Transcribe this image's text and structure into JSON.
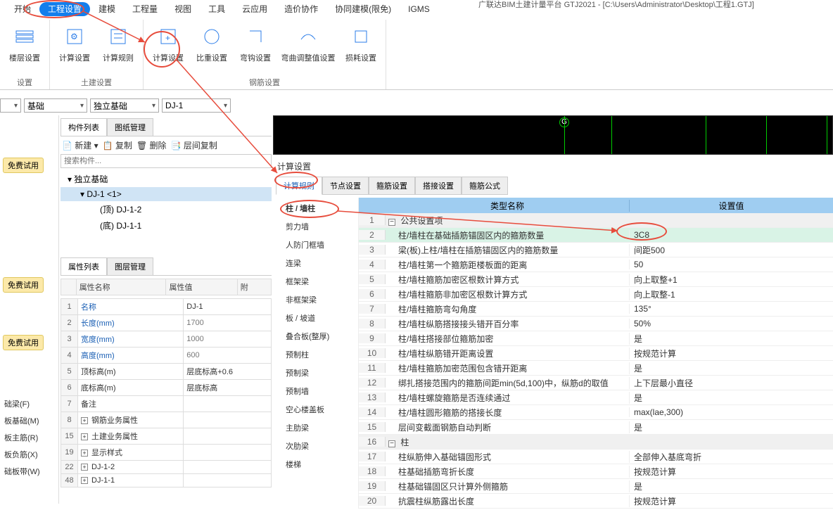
{
  "title": "广联达BIM土建计量平台 GTJ2021 - [C:\\Users\\Administrator\\Desktop\\工程1.GTJ]",
  "menu": [
    "开始",
    "工程设置",
    "建模",
    "工程量",
    "视图",
    "工具",
    "云应用",
    "造价协作",
    "协同建模(限免)",
    "IGMS"
  ],
  "ribbon": {
    "groups": [
      {
        "label": "设置",
        "buttons": [
          {
            "label": "楼层设置"
          }
        ]
      },
      {
        "label": "土建设置",
        "buttons": [
          {
            "label": "计算设置"
          },
          {
            "label": "计算规则"
          }
        ]
      },
      {
        "label": "钢筋设置",
        "buttons": [
          {
            "label": "计算设置"
          },
          {
            "label": "比重设置"
          },
          {
            "label": "弯钩设置"
          },
          {
            "label": "弯曲调整值设置"
          },
          {
            "label": "损耗设置"
          }
        ]
      }
    ]
  },
  "selectors": {
    "cat": "基础",
    "type": "独立基础",
    "comp": "DJ-1"
  },
  "leftSections": [
    "础梁(F)",
    "板基础(M)",
    "板主筋(R)",
    "板负筋(X)",
    "础板带(W)"
  ],
  "trial": "免费试用",
  "componentList": {
    "tabs": [
      "构件列表",
      "图纸管理"
    ],
    "toolbar": {
      "new": "新建",
      "copy": "复制",
      "delete": "删除",
      "layerCopy": "层间复制"
    },
    "searchPlaceholder": "搜索构件...",
    "tree": [
      {
        "l": 1,
        "label": "▾ 独立基础"
      },
      {
        "l": 2,
        "label": "▾ DJ-1  <1>",
        "sel": true
      },
      {
        "l": 3,
        "label": "(顶) DJ-1-2"
      },
      {
        "l": 3,
        "label": "(底) DJ-1-1"
      }
    ]
  },
  "propList": {
    "tabs": [
      "属性列表",
      "图层管理"
    ],
    "headers": [
      "",
      "属性名称",
      "属性值",
      "附"
    ],
    "rows": [
      {
        "n": "1",
        "name": "名称",
        "val": "DJ-1",
        "blue": true
      },
      {
        "n": "2",
        "name": "长度(mm)",
        "val": "1700",
        "blue": true,
        "gray": true
      },
      {
        "n": "3",
        "name": "宽度(mm)",
        "val": "1000",
        "blue": true,
        "gray": true
      },
      {
        "n": "4",
        "name": "高度(mm)",
        "val": "600",
        "blue": true,
        "gray": true
      },
      {
        "n": "5",
        "name": "顶标高(m)",
        "val": "层底标高+0.6"
      },
      {
        "n": "6",
        "name": "底标高(m)",
        "val": "层底标高"
      },
      {
        "n": "7",
        "name": "备注",
        "val": ""
      },
      {
        "n": "8",
        "name": "钢筋业务属性",
        "val": "",
        "expand": true
      },
      {
        "n": "15",
        "name": "土建业务属性",
        "val": "",
        "expand": true
      },
      {
        "n": "19",
        "name": "显示样式",
        "val": "",
        "expand": true
      },
      {
        "n": "22",
        "name": "DJ-1-2",
        "val": "",
        "expand": true
      },
      {
        "n": "48",
        "name": "DJ-1-1",
        "val": "",
        "expand": true
      }
    ]
  },
  "calcPanel": {
    "title": "计算设置",
    "tabs": [
      "计算规则",
      "节点设置",
      "箍筋设置",
      "搭接设置",
      "箍筋公式"
    ],
    "side": [
      "柱 / 墙柱",
      "剪力墙",
      "人防门框墙",
      "连梁",
      "框架梁",
      "非框架梁",
      "板 / 坡道",
      "叠合板(整厚)",
      "预制柱",
      "预制梁",
      "预制墙",
      "空心楼盖板",
      "主肋梁",
      "次肋梁",
      "楼梯"
    ],
    "header": {
      "name": "类型名称",
      "val": "设置值"
    },
    "rows": [
      {
        "n": "1",
        "name": "公共设置项",
        "header": true
      },
      {
        "n": "2",
        "name": "柱/墙柱在基础插筋锚固区内的箍筋数量",
        "val": "3C8",
        "sel": true
      },
      {
        "n": "3",
        "name": "梁(板)上柱/墙柱在插筋锚固区内的箍筋数量",
        "val": "间距500"
      },
      {
        "n": "4",
        "name": "柱/墙柱第一个箍筋距楼板面的距离",
        "val": "50"
      },
      {
        "n": "5",
        "name": "柱/墙柱箍筋加密区根数计算方式",
        "val": "向上取整+1"
      },
      {
        "n": "6",
        "name": "柱/墙柱箍筋非加密区根数计算方式",
        "val": "向上取整-1"
      },
      {
        "n": "7",
        "name": "柱/墙柱箍筋弯勾角度",
        "val": "135°"
      },
      {
        "n": "8",
        "name": "柱/墙柱纵筋搭接接头错开百分率",
        "val": "50%"
      },
      {
        "n": "9",
        "name": "柱/墙柱搭接部位箍筋加密",
        "val": "是"
      },
      {
        "n": "10",
        "name": "柱/墙柱纵筋错开距离设置",
        "val": "按规范计算"
      },
      {
        "n": "11",
        "name": "柱/墙柱箍筋加密范围包含错开距离",
        "val": "是"
      },
      {
        "n": "12",
        "name": "绑扎搭接范围内的箍筋间距min(5d,100)中，纵筋d的取值",
        "val": "上下层最小直径"
      },
      {
        "n": "13",
        "name": "柱/墙柱螺旋箍筋是否连续通过",
        "val": "是"
      },
      {
        "n": "14",
        "name": "柱/墙柱圆形箍筋的搭接长度",
        "val": "max(lae,300)"
      },
      {
        "n": "15",
        "name": "层间变截面钢筋自动判断",
        "val": "是"
      },
      {
        "n": "16",
        "name": "柱",
        "header": true
      },
      {
        "n": "17",
        "name": "柱纵筋伸入基础锚固形式",
        "val": "全部伸入基底弯折"
      },
      {
        "n": "18",
        "name": "柱基础插筋弯折长度",
        "val": "按规范计算"
      },
      {
        "n": "19",
        "name": "柱基础锚固区只计算外侧箍筋",
        "val": "是"
      },
      {
        "n": "20",
        "name": "抗震柱纵筋露出长度",
        "val": "按规范计算"
      }
    ]
  },
  "viewport": {
    "label": "G"
  }
}
